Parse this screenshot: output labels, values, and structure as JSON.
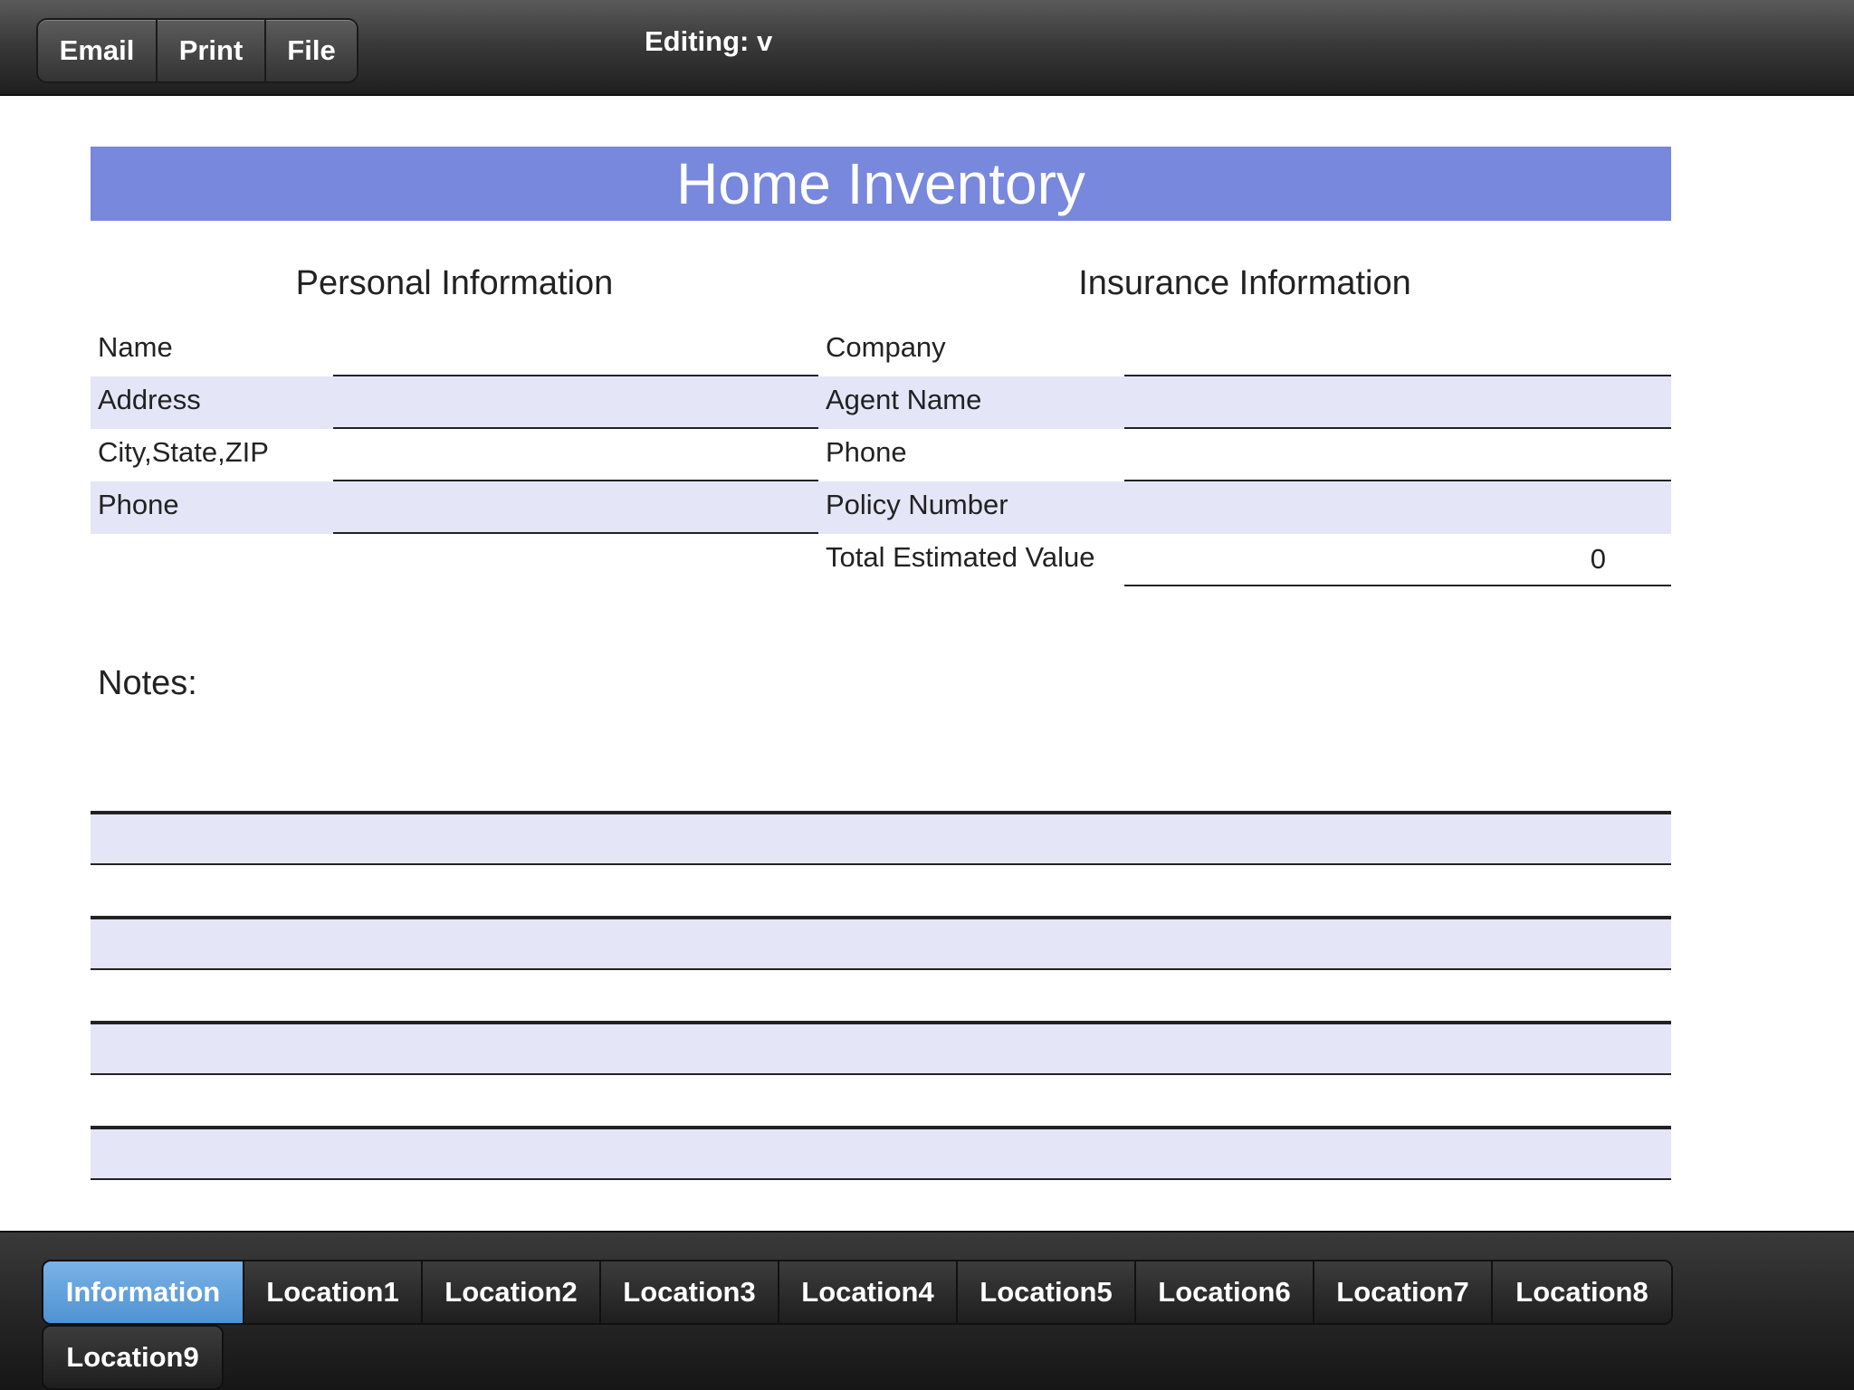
{
  "toolbar": {
    "buttons": [
      {
        "label": "Email"
      },
      {
        "label": "Print"
      },
      {
        "label": "File"
      }
    ],
    "editing_title": "Editing: v"
  },
  "form": {
    "title": "Home Inventory",
    "banner_color": "#7888dd",
    "row_alt_color": "#e4e6f8",
    "personal": {
      "heading": "Personal Information",
      "fields": [
        {
          "label": "Name",
          "value": ""
        },
        {
          "label": "Address",
          "value": ""
        },
        {
          "label": "City,State,ZIP",
          "value": ""
        },
        {
          "label": "Phone",
          "value": ""
        }
      ]
    },
    "insurance": {
      "heading": "Insurance Information",
      "fields": [
        {
          "label": "Company",
          "value": ""
        },
        {
          "label": "Agent Name",
          "value": ""
        },
        {
          "label": "Phone",
          "value": ""
        },
        {
          "label": "Policy Number",
          "value": ""
        },
        {
          "label": "Total Estimated Value",
          "value": "0"
        }
      ]
    },
    "notes": {
      "label": "Notes:",
      "lines": [
        "",
        "",
        "",
        "",
        "",
        "",
        "",
        ""
      ]
    }
  },
  "tabs": {
    "active": "Information",
    "active_color": "#5b9bd9",
    "row1": [
      {
        "label": "Information"
      },
      {
        "label": "Location1"
      },
      {
        "label": "Location2"
      },
      {
        "label": "Location3"
      },
      {
        "label": "Location4"
      },
      {
        "label": "Location5"
      },
      {
        "label": "Location6"
      },
      {
        "label": "Location7"
      },
      {
        "label": "Location8"
      }
    ],
    "row2": [
      {
        "label": "Location9"
      }
    ]
  }
}
